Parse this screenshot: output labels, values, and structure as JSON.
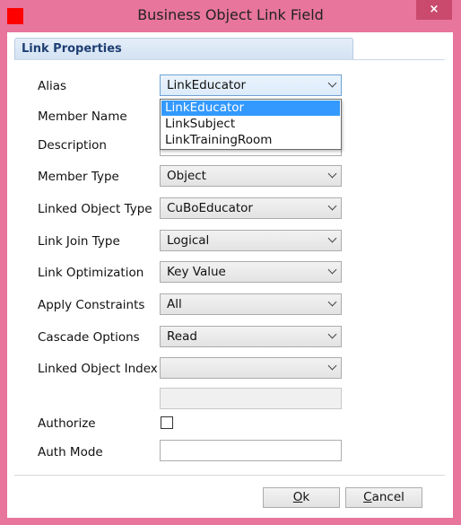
{
  "window": {
    "title": "Business Object Link Field",
    "close_glyph": "×",
    "app_icon_color": "#ff0000",
    "frame_color": "#e8759b"
  },
  "panel": {
    "title": "Link Properties"
  },
  "fields": {
    "alias": {
      "label": "Alias",
      "value": "LinkEducator"
    },
    "member_name": {
      "label": "Member Name",
      "value": ""
    },
    "description": {
      "label": "Description",
      "value": ""
    },
    "member_type": {
      "label": "Member Type",
      "value": "Object"
    },
    "linked_object_type": {
      "label": "Linked Object Type",
      "value": "CuBoEducator"
    },
    "link_join_type": {
      "label": "Link Join Type",
      "value": "Logical"
    },
    "link_optimization": {
      "label": "Link Optimization",
      "value": "Key Value"
    },
    "apply_constraints": {
      "label": "Apply Constraints",
      "value": "All"
    },
    "cascade_options": {
      "label": "Cascade Options",
      "value": "Read"
    },
    "linked_object_index": {
      "label": "Linked Object Index",
      "value": ""
    },
    "authorize": {
      "label": "Authorize",
      "checked": false
    },
    "auth_mode": {
      "label": "Auth Mode",
      "value": ""
    }
  },
  "alias_dropdown": {
    "options": [
      "LinkEducator",
      "LinkSubject",
      "LinkTrainingRoom"
    ],
    "selected_index": 0,
    "highlight_color": "#3399ff"
  },
  "buttons": {
    "ok": {
      "mnemonic": "O",
      "rest": "k"
    },
    "cancel": {
      "mnemonic": "C",
      "rest": "ancel"
    }
  }
}
